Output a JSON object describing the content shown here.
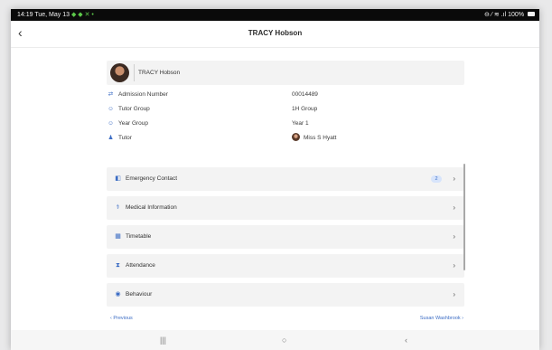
{
  "status_bar": {
    "time": "14:19",
    "date": "Tue, May 13",
    "indicators": "◆ ◆ ✕ •",
    "right_icons": "⊖ ⁄ ≋ .ıl",
    "battery": "100%"
  },
  "header": {
    "back_icon": "‹",
    "title": "TRACY Hobson"
  },
  "profile": {
    "name": "TRACY Hobson"
  },
  "info": {
    "rows": [
      {
        "icon": "⇄",
        "label": "Admission Number",
        "value": "00014489"
      },
      {
        "icon": "☺",
        "label": "Tutor Group",
        "value": "1H Group"
      },
      {
        "icon": "☺",
        "label": "Year Group",
        "value": "Year 1"
      },
      {
        "icon": "♟",
        "label": "Tutor",
        "value": "Miss S Hyatt"
      }
    ]
  },
  "menu": {
    "items": [
      {
        "icon": "◧",
        "label": "Emergency Contact",
        "badge": "2",
        "chevron": "›"
      },
      {
        "icon": "⚕",
        "label": "Medical Information",
        "chevron": "›"
      },
      {
        "icon": "▦",
        "label": "Timetable",
        "chevron": "›"
      },
      {
        "icon": "⧗",
        "label": "Attendance",
        "chevron": "›"
      },
      {
        "icon": "◉",
        "label": "Behaviour",
        "chevron": "›"
      }
    ]
  },
  "pager": {
    "previous": "‹ Previous",
    "next": "Susan Washbrook ›"
  },
  "nav_bar": {
    "recents": "|||",
    "home": "○",
    "back": "‹"
  },
  "colors": {
    "accent": "#3b6cc4",
    "badge_bg": "#d7e4fb",
    "card_bg": "#f3f3f3"
  }
}
